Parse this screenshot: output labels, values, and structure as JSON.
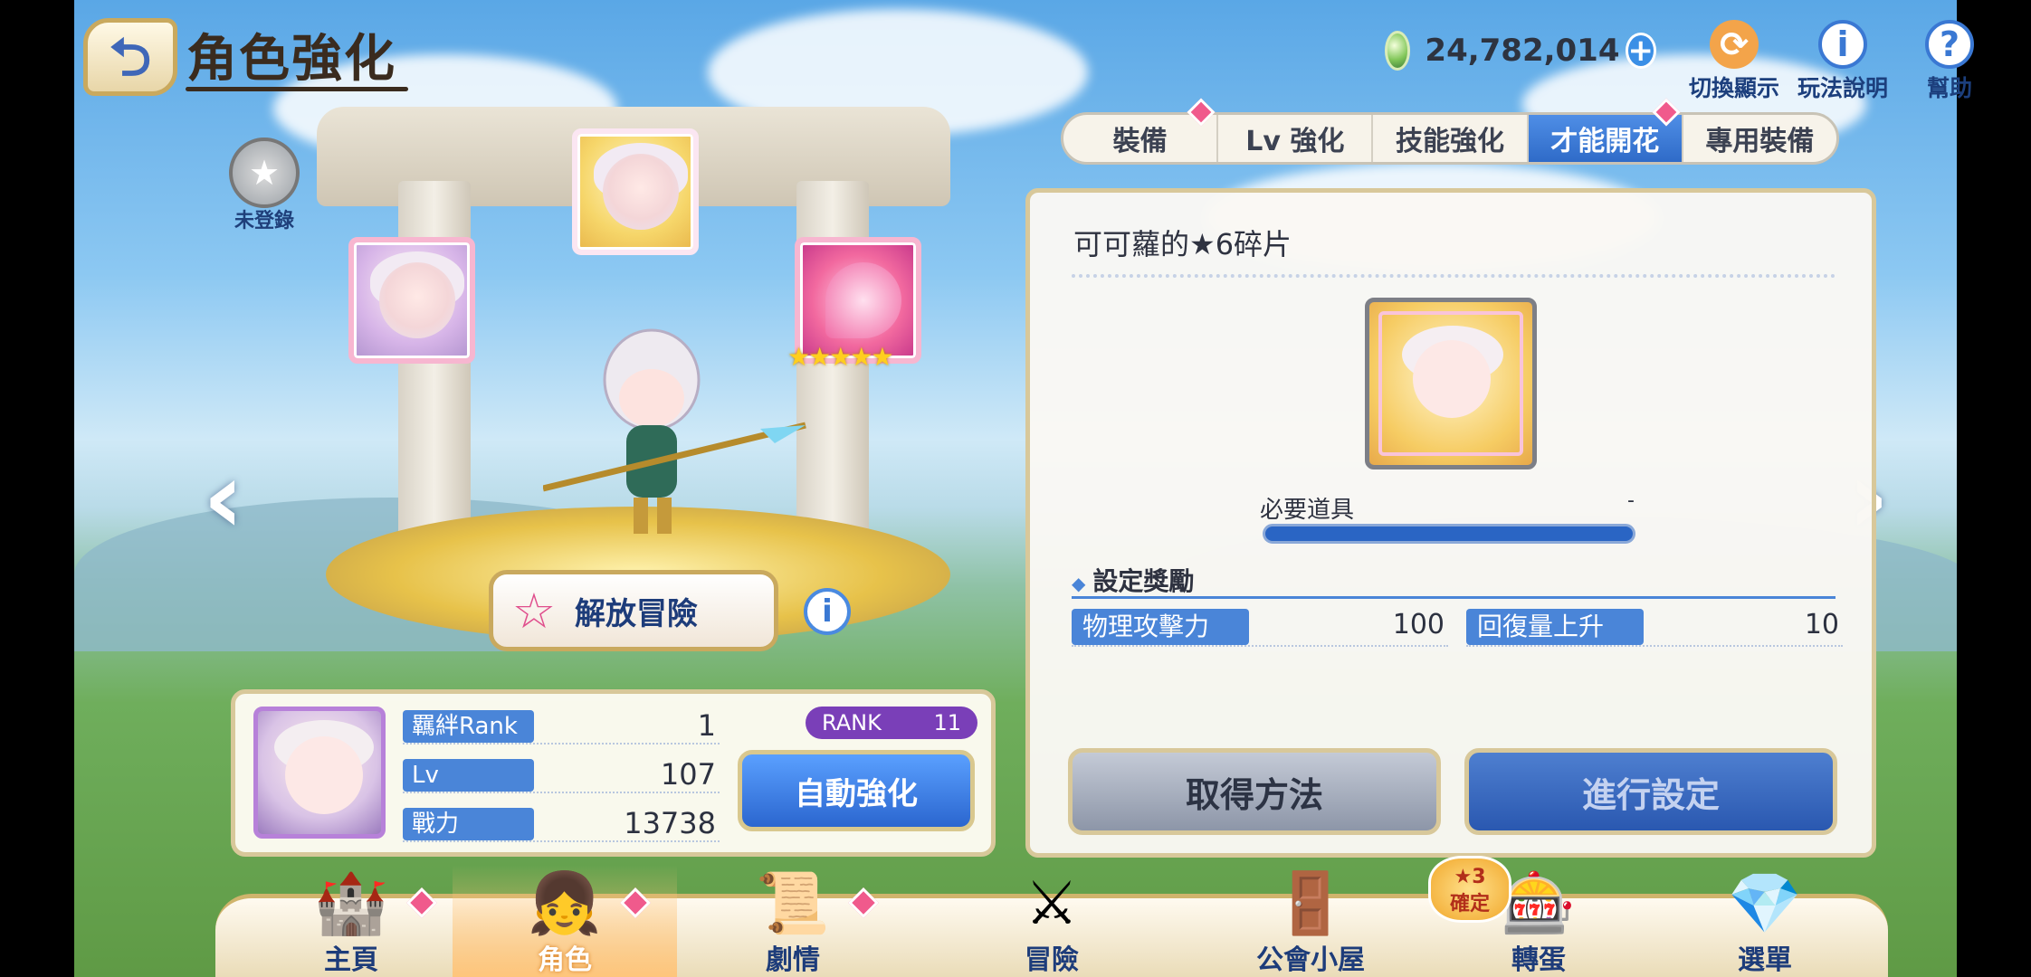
{
  "header": {
    "title": "角色強化",
    "back_glyph": "⮌"
  },
  "currency": {
    "icon": "jewel-icon",
    "value": "24,782,014",
    "plus": "+"
  },
  "top_tools": [
    {
      "label": "切換顯示",
      "icon": "switch-display-icon",
      "glyph": "⟳"
    },
    {
      "label": "玩法說明",
      "icon": "info-icon",
      "glyph": "i"
    },
    {
      "label": "幫助",
      "icon": "help-icon",
      "glyph": "?"
    }
  ],
  "tabs": [
    {
      "label": "裝備",
      "notify": true
    },
    {
      "label": "Lv 強化",
      "notify": false
    },
    {
      "label": "技能強化",
      "notify": false
    },
    {
      "label": "才能開花",
      "notify": true,
      "active": true
    },
    {
      "label": "專用裝備",
      "notify": false
    }
  ],
  "stage": {
    "unregistered_label": "未登錄",
    "release_button": "解放冒險",
    "info_glyph": "i",
    "stars": "★★★★★",
    "prev_arrow": "‹",
    "next_arrow": "›"
  },
  "char_panel": {
    "stats": [
      {
        "label": "羈絆Rank",
        "value": "1"
      },
      {
        "label": "Lv",
        "value": "107"
      },
      {
        "label": "戰力",
        "value": "13738"
      }
    ],
    "rank_label": "RANK",
    "rank_value": "11",
    "auto_button": "自動強化"
  },
  "unlock_panel": {
    "title": "可可蘿的★6碎片",
    "required_label": "必要道具",
    "required_value": "-",
    "section_title": "設定獎勵",
    "rewards": [
      {
        "label": "物理攻擊力",
        "value": "100"
      },
      {
        "label": "回復量上升",
        "value": "10"
      }
    ],
    "get_button": "取得方法",
    "set_button": "進行設定"
  },
  "bottom_nav": [
    {
      "label": "主頁",
      "icon": "castle-icon",
      "glyph": "🏰",
      "notify": true
    },
    {
      "label": "角色",
      "icon": "character-icon",
      "glyph": "👧",
      "notify": true,
      "active": true
    },
    {
      "label": "劇情",
      "icon": "scroll-icon",
      "glyph": "📜",
      "notify": true
    },
    {
      "label": "冒險",
      "icon": "sword-flag-icon",
      "glyph": "⚔",
      "notify": false
    },
    {
      "label": "公會小屋",
      "icon": "house-icon",
      "glyph": "🚪",
      "notify": false
    },
    {
      "label": "轉蛋",
      "icon": "gacha-icon",
      "glyph": "🎰",
      "notify": false
    },
    {
      "label": "選單",
      "icon": "crystal-icon",
      "glyph": "💎",
      "notify": false
    }
  ],
  "gacha_badge": {
    "line1": "★3",
    "line2": "確定"
  },
  "colors": {
    "accent_blue": "#2f6bc8",
    "notify_pink": "#f05a8c",
    "gold_border": "#d8c89a"
  }
}
